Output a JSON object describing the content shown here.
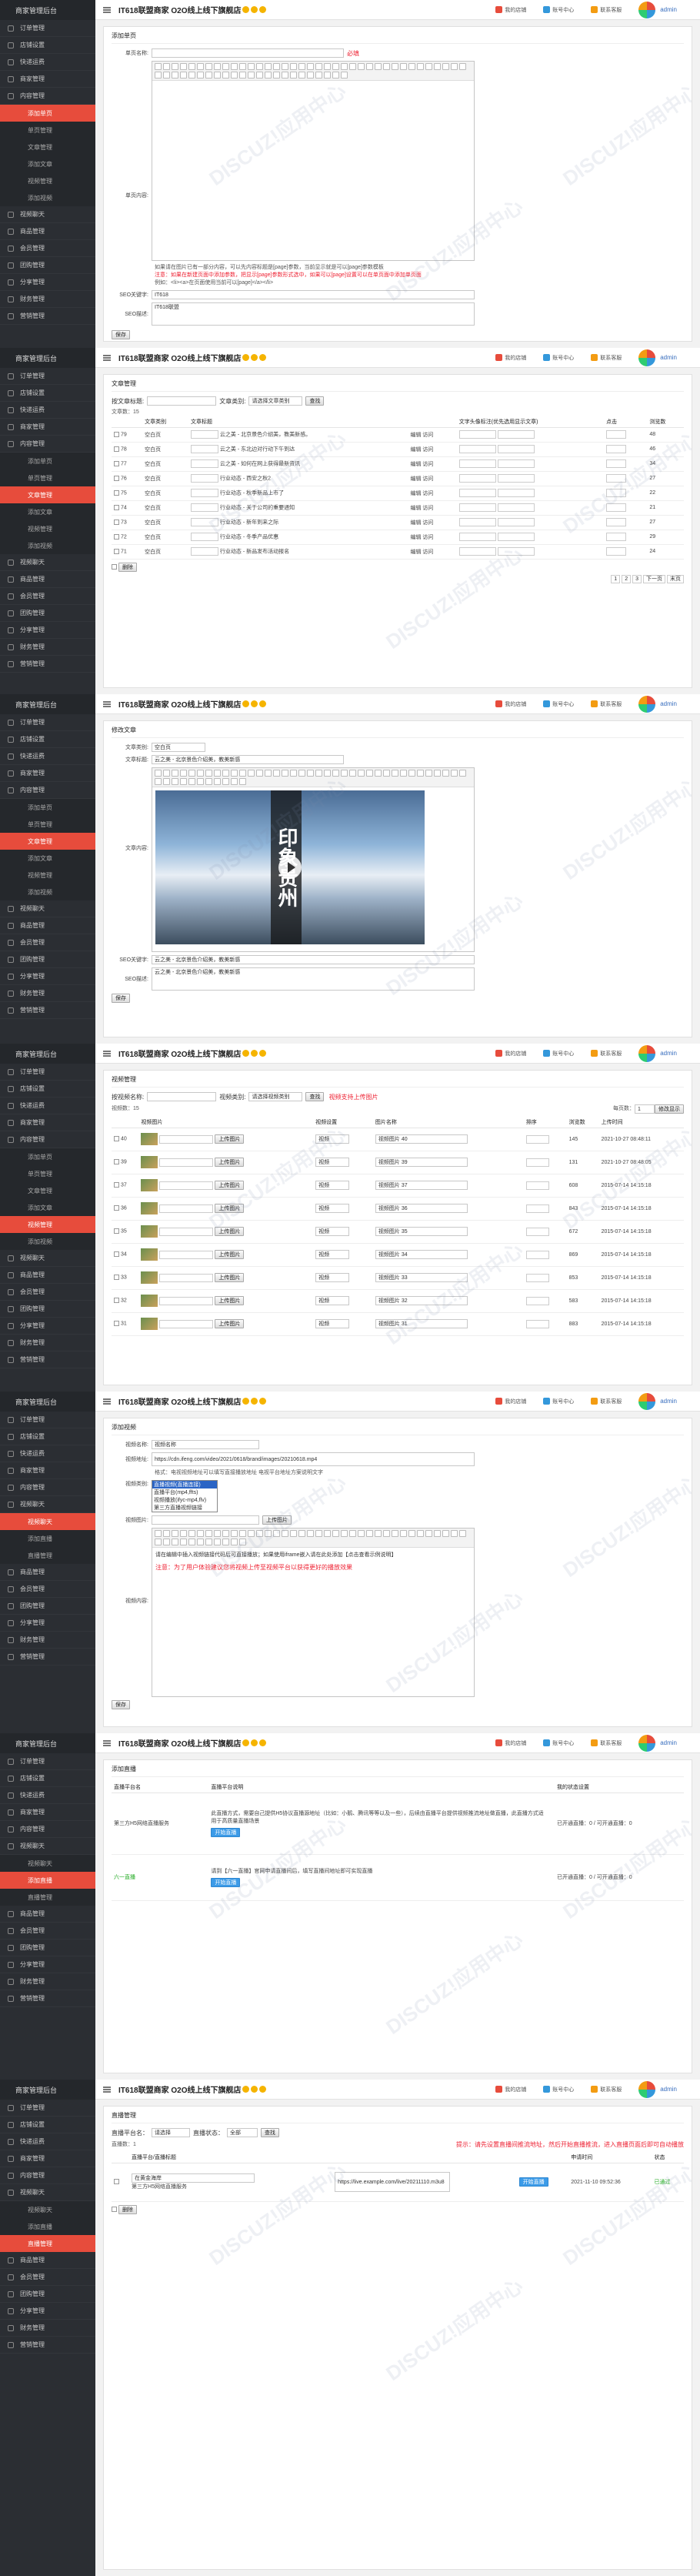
{
  "common": {
    "app": "商家管理后台",
    "title": "IT618联盟商家 O2O线上线下旗舰店",
    "links": [
      "我的店铺",
      "账号中心",
      "联系客服"
    ],
    "admin": "admin",
    "menu": [
      {
        "label": "订单管理"
      },
      {
        "label": "店铺设置"
      },
      {
        "label": "快递运费"
      },
      {
        "label": "商家管理"
      },
      {
        "label": "内容管理",
        "sub": [
          "添加单页",
          "单页管理",
          "文章管理",
          "添加文章",
          "视频管理",
          "添加视频"
        ]
      },
      {
        "label": "视频聊天",
        "sub": [
          "视频聊天",
          "添加直播",
          "直播管理"
        ]
      },
      {
        "label": "商品管理"
      },
      {
        "label": "会员管理"
      },
      {
        "label": "团购管理"
      },
      {
        "label": "分享管理"
      },
      {
        "label": "财务管理"
      },
      {
        "label": "营销管理"
      }
    ],
    "watermark": "DISCUZ!应用中心"
  },
  "s1": {
    "heading": "添加单页",
    "label_title": "单页名称:",
    "required": "必填",
    "label_content": "单页内容:",
    "note1": "如果请在图片已有一部分内容，可以先内容标题是[page]参数，当前显示就是可以[page]参数模板",
    "note2": "注意：如果在新建页面中添加参数，把显示[page]参数形式选中，如果可以[page]设置可以在单页面中添加单页面",
    "note3": "例如：<li><a>在页面使用当前可以[page]</a></li>",
    "label_seo": "SEO关键字:",
    "seo_val": "IT618",
    "label_desc": "SEO描述:",
    "desc_val": "IT618联盟",
    "save": "保存"
  },
  "s2": {
    "heading": "文章管理",
    "search_label": "按文章标题:",
    "type_label": "文章类别:",
    "type_val": "请选择文章类别",
    "search_btn": "查找",
    "count": "文章数：15",
    "cols": [
      "",
      "文章类别",
      "文章标题",
      "",
      "文字头像标注(优先选用显示文章)",
      "点击",
      "浏览数"
    ],
    "rows": [
      {
        "id": "79",
        "cat": "空白页",
        "title": "云之美 - 北京景色介绍美，教美新感。",
        "edit": "编辑 访问",
        "views": "48"
      },
      {
        "id": "78",
        "cat": "空白页",
        "title": "云之美 - 东北边对行动下午到达",
        "edit": "编辑 访问",
        "views": "46"
      },
      {
        "id": "77",
        "cat": "空白页",
        "title": "云之美 - 如何在网上获得最新资讯",
        "edit": "编辑 访问",
        "views": "34"
      },
      {
        "id": "76",
        "cat": "空白页",
        "title": "行业动态 - 西安之秋2",
        "edit": "编辑 访问",
        "views": "27"
      },
      {
        "id": "75",
        "cat": "空白页",
        "title": "行业动态 - 秋季新品上市了",
        "edit": "编辑 访问",
        "views": "22"
      },
      {
        "id": "74",
        "cat": "空白页",
        "title": "行业动态 - 关于公司的重要通知",
        "edit": "编辑 访问",
        "views": "21"
      },
      {
        "id": "73",
        "cat": "空白页",
        "title": "行业动态 - 新年到来之际",
        "edit": "编辑 访问",
        "views": "27"
      },
      {
        "id": "72",
        "cat": "空白页",
        "title": "行业动态 - 冬季产品优惠",
        "edit": "编辑 访问",
        "views": "29"
      },
      {
        "id": "71",
        "cat": "空白页",
        "title": "行业动态 - 新品发布活动报名",
        "edit": "编辑 访问",
        "views": "24"
      }
    ],
    "del": "删除",
    "pages": [
      "1",
      "2",
      "3",
      "下一页",
      "末页"
    ]
  },
  "s3": {
    "heading": "修改文章",
    "cat_label": "文章类别:",
    "cat_val": "空白页",
    "title_label": "文章标题:",
    "title_val": "云之美 - 北京景色介绍美，教美新感",
    "content_label": "文章内容:",
    "banner": "印象贵州",
    "seo_label": "SEO关键字:",
    "seo_val": "云之美 - 北京景色介绍美，教美新感",
    "desc_label": "SEO描述:",
    "desc_val": "云之美 - 北京景色介绍美，教美新感",
    "save": "保存"
  },
  "s4": {
    "heading": "视频管理",
    "search_label": "按视频名称:",
    "type_label": "视频类别:",
    "type_val": "请选择视频类别",
    "search_btn": "查找",
    "hint": "视频支持上传图片",
    "count": "视频数：15",
    "cols": [
      "",
      "视频图片",
      "",
      "视频设置",
      "图片名称",
      "排序",
      "浏览数",
      "上传时间"
    ],
    "rows": [
      {
        "id": "40",
        "name": "视频图片 40",
        "views": "145",
        "date": "2021-10-27 08:48:11"
      },
      {
        "id": "39",
        "name": "视频图片 39",
        "views": "131",
        "date": "2021-10-27 08:48:05"
      },
      {
        "id": "37",
        "name": "视频图片 37",
        "views": "608",
        "date": "2015-07-14 14:15:18"
      },
      {
        "id": "36",
        "name": "视频图片 36",
        "views": "843",
        "date": "2015-07-14 14:15:18"
      },
      {
        "id": "35",
        "name": "视频图片 35",
        "views": "672",
        "date": "2015-07-14 14:15:18"
      },
      {
        "id": "34",
        "name": "视频图片 34",
        "views": "869",
        "date": "2015-07-14 14:15:18"
      },
      {
        "id": "33",
        "name": "视频图片 33",
        "views": "853",
        "date": "2015-07-14 14:15:18"
      },
      {
        "id": "32",
        "name": "视频图片 32",
        "views": "583",
        "date": "2015-07-14 14:15:18"
      },
      {
        "id": "31",
        "name": "视频图片 31",
        "views": "883",
        "date": "2015-07-14 14:15:18"
      }
    ],
    "upload": "上传图片",
    "sel": "视频",
    "pg_label": "每页数：",
    "pg_val": "1",
    "pg_btn": "修改显示"
  },
  "s5": {
    "heading": "添加视频",
    "name_label": "视频名称:",
    "name_val": "视频名称",
    "addr_label": "视频地址:",
    "addr_val": "https://cdn.ifeng.com/video/2021/0618/brand/images/20210618.mp4",
    "note": "格式：电视视频地址可以填写直接播放地址 电视平台地址方案说明文字",
    "type_label": "视频类别:",
    "type_val": "直播视频(直播连接)",
    "opts": [
      "直播视频(直播连接)",
      "直播平台(mp4,ffts)",
      "视频播放(ifyc-mp4,flv)",
      "第三方直播视频链接"
    ],
    "img_label": "视频图片:",
    "upload": "上传图片",
    "desc_label": "视频内容:",
    "desc_text": "请在编辑中插入视频链接代码后可直接播放；如果使用iframe嵌入请在此处添加【点击查看示例说明】",
    "desc_red": "注意：为了用户体验建议您将视频上传至视频平台以获得更好的播放效果",
    "save": "保存"
  },
  "s6": {
    "heading": "添加直播",
    "cols": [
      "直播平台名",
      "直播平台说明",
      "",
      "我的状态设置"
    ],
    "p1": "第三方H5网络直播服务",
    "p1_desc": "此直播方式，需要自己提供H5协议直播源地址（比如：小鹅、腾讯等等以及一些），后续由直播平台提供视频推流地址做直播，此直播方式适用于高质量直播场景",
    "p1_status": "已开通直播：0 / 可开通直播：0",
    "p2": "六一直播",
    "p2_desc": "请到【六一直播】官网申请直播间后，填写直播间地址即可实现直播",
    "p2_status": "已开通直播：0 / 可开通直播：0",
    "apply": "开始直播"
  },
  "s7": {
    "heading": "直播管理",
    "search_label": "直播平台名：",
    "search_val": "请选择",
    "status_label": "直播状态：",
    "status_val": "全部",
    "search_btn": "查找",
    "count": "直播数：1",
    "cols": [
      "",
      "直播平台/直播标题",
      "",
      "",
      "",
      "申请时间",
      "状态"
    ],
    "note": "提示：请先设置直播间推流地址，然后开始直播推流，进入直播页面后即可自动播放",
    "row_title": "在黄金海岸",
    "row_platform": "第三方H5网络直播服务",
    "row_time": "2021-11-10 09:52:36",
    "row_status": "已通过",
    "row_url": "https://live.example.com/live/20211110.m3u8",
    "del": "删除",
    "start": "开始直播"
  }
}
